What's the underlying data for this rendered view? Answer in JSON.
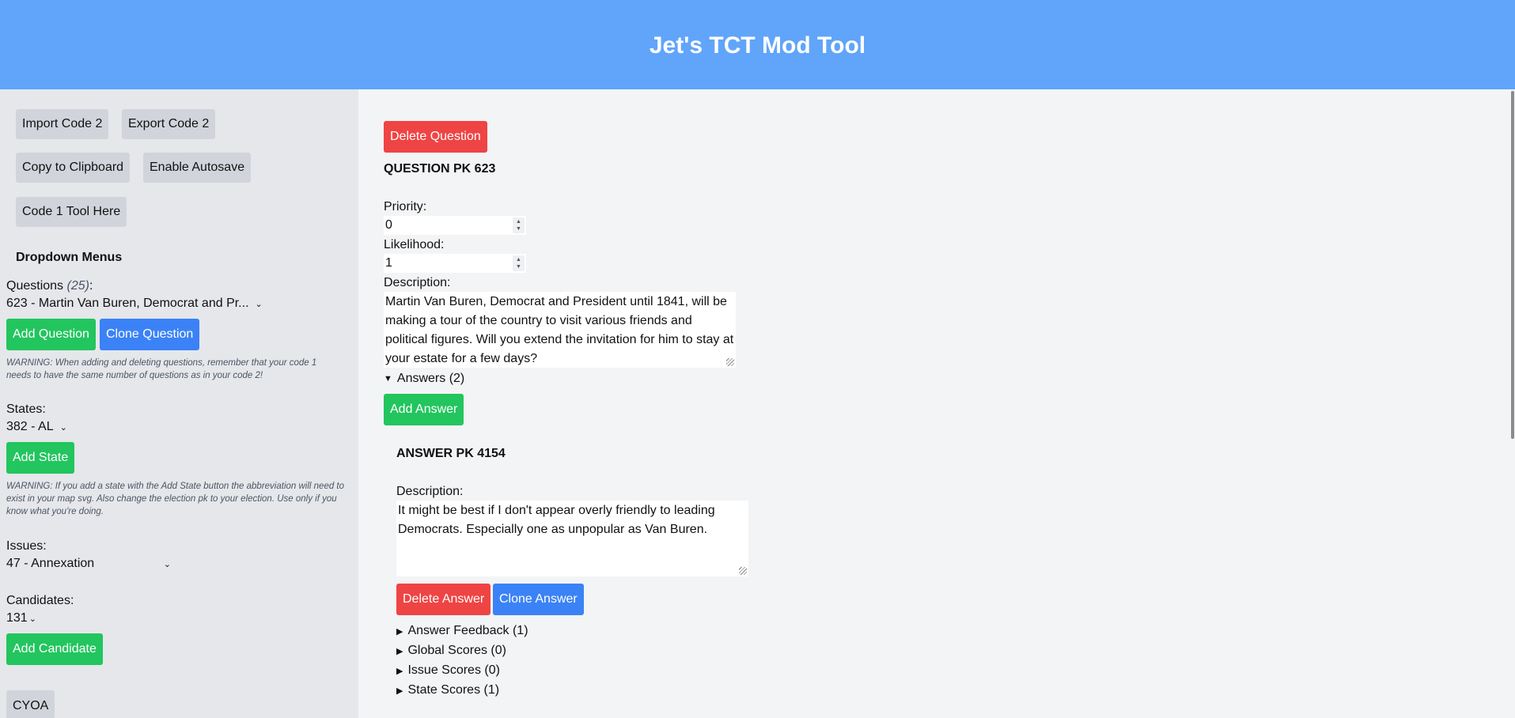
{
  "app": {
    "title": "Jet's TCT Mod Tool"
  },
  "sidebar": {
    "buttons": {
      "import": "Import Code 2",
      "export": "Export Code 2",
      "copy": "Copy to Clipboard",
      "autosave": "Enable Autosave",
      "code1": "Code 1 Tool Here"
    },
    "dropdown_heading": "Dropdown Menus",
    "questions": {
      "label": "Questions",
      "count": "(25)",
      "colon": ":",
      "selected": "623 - Martin Van Buren, Democrat and Pr...",
      "add_label": "Add Question",
      "clone_label": "Clone Question",
      "warning": "WARNING: When adding and deleting questions, remember that your code 1 needs to have the same number of questions as in your code 2!"
    },
    "states": {
      "label": "States:",
      "selected": "382 - AL",
      "add_label": "Add State",
      "warning": "WARNING: If you add a state with the Add State button the abbreviation will need to exist in your map svg. Also change the election pk to your election. Use only if you know what you're doing."
    },
    "issues": {
      "label": "Issues:",
      "selected": "47 - Annexation"
    },
    "candidates": {
      "label": "Candidates:",
      "selected": "131",
      "add_label": "Add Candidate"
    },
    "cyoa_label": "CYOA"
  },
  "question": {
    "delete_label": "Delete Question",
    "heading": "QUESTION PK 623",
    "priority_label": "Priority:",
    "priority_value": "0",
    "likelihood_label": "Likelihood:",
    "likelihood_value": "1",
    "description_label": "Description:",
    "description": "Martin Van Buren, Democrat and President until 1841, will be making a tour of the country to visit various friends and political figures. Will you extend the invitation for him to stay at your estate for a few days?",
    "answers_summary": "Answers (2)",
    "add_answer_label": "Add Answer"
  },
  "answer": {
    "heading": "ANSWER PK 4154",
    "description_label": "Description:",
    "description": "It might be best if I don't appear overly friendly to leading Democrats. Especially one as unpopular as Van Buren.",
    "delete_label": "Delete Answer",
    "clone_label": "Clone Answer",
    "sections": [
      "Answer Feedback (1)",
      "Global Scores (0)",
      "Issue Scores (0)",
      "State Scores (1)"
    ]
  },
  "icons": {
    "dropdown": "chevron-down-icon",
    "expanded": "triangle-down-icon",
    "collapsed": "triangle-right-icon",
    "resize": "resize-grip-icon"
  },
  "colors": {
    "header": "#60a5fa",
    "green": "#22c55e",
    "blue": "#3b82f6",
    "red": "#ef4444",
    "gray_button": "#d1d5db"
  }
}
